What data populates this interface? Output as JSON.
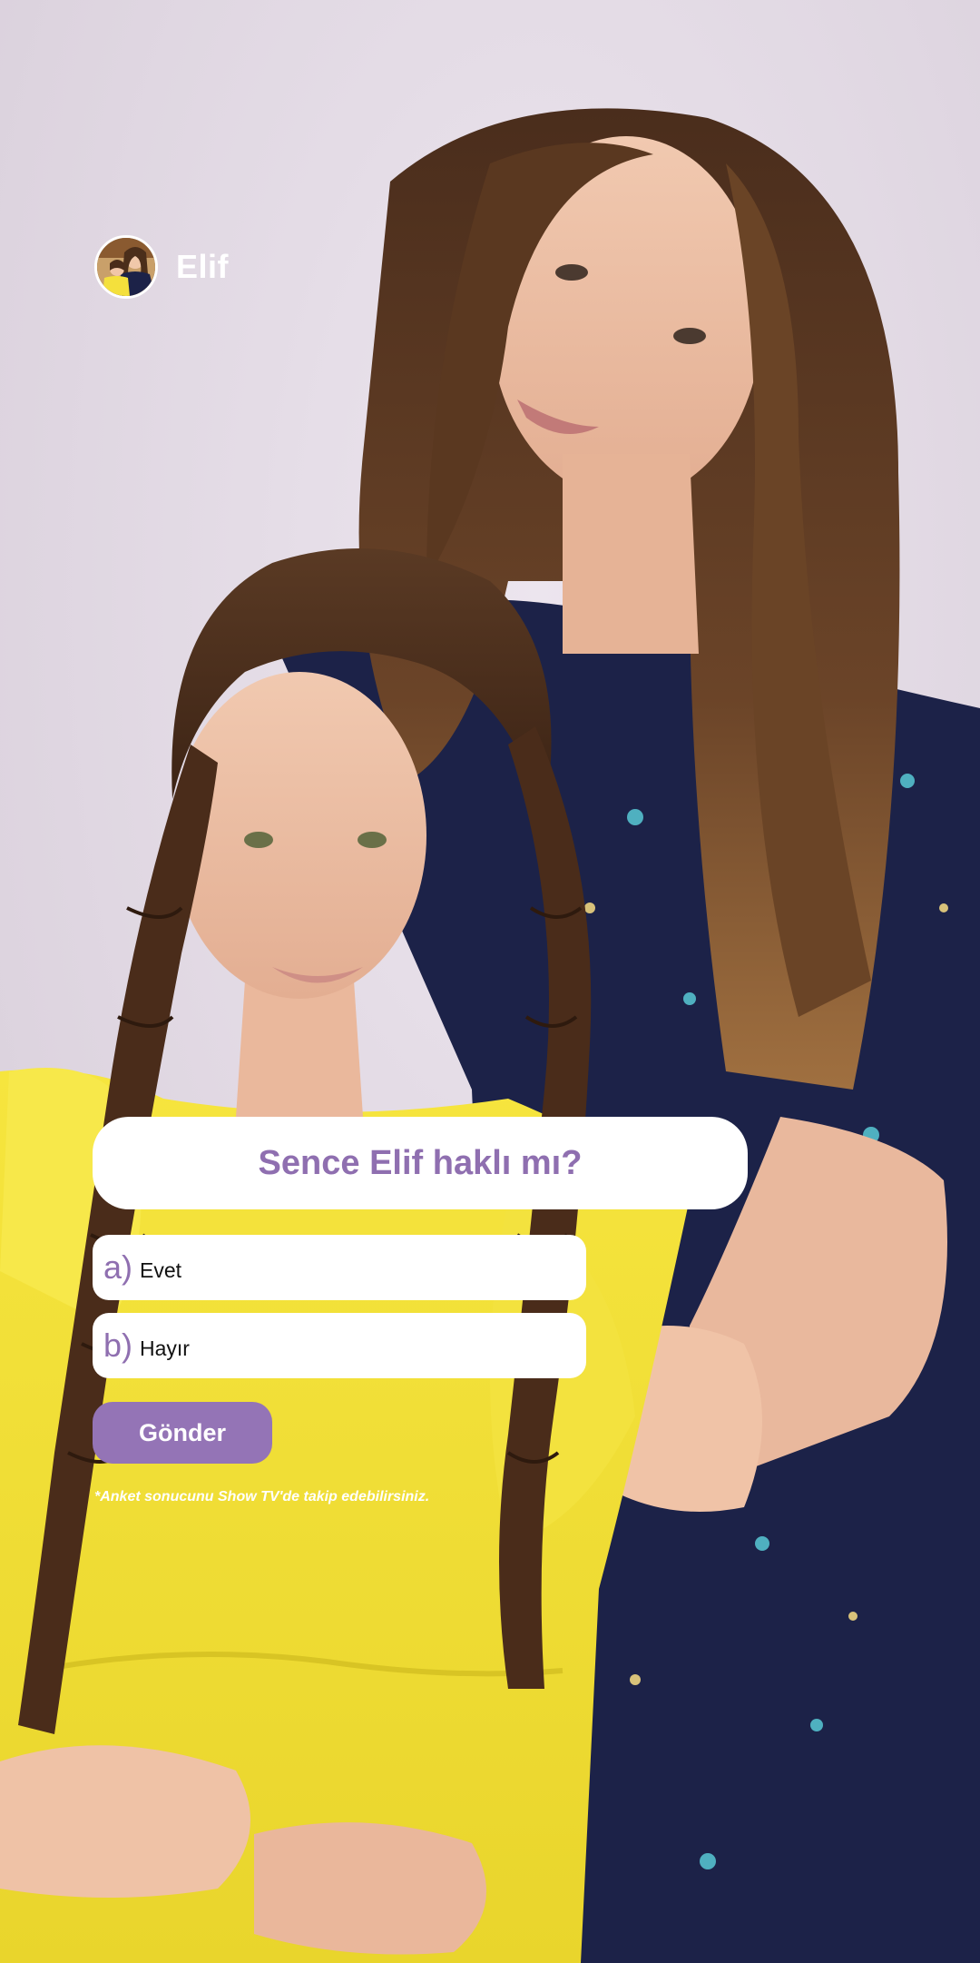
{
  "header": {
    "channel_name": "Elif"
  },
  "poll": {
    "question": "Sence Elif haklı mı?",
    "options": [
      {
        "letter": "a)",
        "label": "Evet"
      },
      {
        "letter": "b)",
        "label": "Hayır"
      }
    ],
    "submit_label": "Gönder",
    "disclaimer": "*Anket sonucunu Show TV'de takip edebilirsiniz."
  },
  "colors": {
    "accent": "#9474b6",
    "question_text": "#8f6fb0",
    "card_background": "#ffffff",
    "background": "#e4dbe6",
    "dress_yellow": "#f2e23a",
    "dress_navy": "#1c2248"
  },
  "icons": {
    "avatar": "channel-avatar"
  }
}
